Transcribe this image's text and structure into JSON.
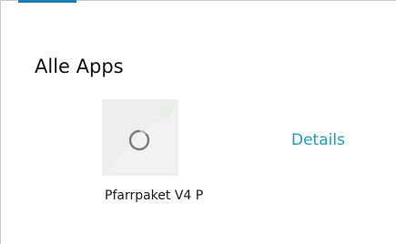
{
  "colors": {
    "accent": "#1e9bbf",
    "tab_indicator": "#1b7fb5",
    "icon_background": "#ececec",
    "spinner": "#7a7a7a"
  },
  "section": {
    "title": "Alle Apps"
  },
  "apps": [
    {
      "name": "Pfarrpaket V4 P",
      "icon": "loading-spinner-icon",
      "details_label": "Details"
    }
  ]
}
